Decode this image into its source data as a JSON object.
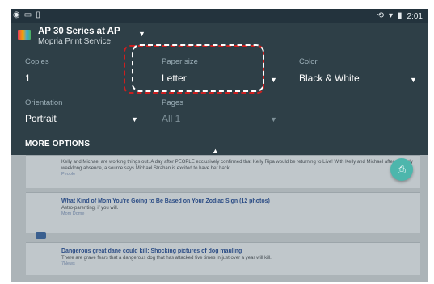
{
  "statusbar": {
    "left_icons": [
      "notification-icon",
      "sim-icon",
      "download-icon"
    ],
    "right_icons": [
      "sync-icon",
      "wifi-icon",
      "battery-icon"
    ],
    "time": "2:01"
  },
  "printer": {
    "name": "AP 30 Series at AP",
    "service": "Mopria Print Service"
  },
  "fields": {
    "copies": {
      "label": "Copies",
      "value": "1"
    },
    "paper_size": {
      "label": "Paper size",
      "value": "Letter"
    },
    "color": {
      "label": "Color",
      "value": "Black & White"
    },
    "orientation": {
      "label": "Orientation",
      "value": "Portrait"
    },
    "pages": {
      "label": "Pages",
      "value": "All 1"
    }
  },
  "more_options": "MORE OPTIONS",
  "articles": [
    {
      "title": "",
      "desc": "Kelly and Michael are working things out. A day after PEOPLE exclusively confirmed that Kelly Ripa would be returning to Live! With Kelly and Michael after a nearly weeklong absence, a source says Michael Strahan is excited to have her back.",
      "src": "People"
    },
    {
      "title": "What Kind of Mom You're Going to Be Based on Your Zodiac Sign (12 photos)",
      "desc": "Astro-parenting, if you will.",
      "src": "Mom Dome"
    },
    {
      "title": "Dangerous great dane could kill: Shocking pictures of dog mauling",
      "desc": "There are grave fears that a dangerous dog that has attacked five times in just over a year will kill.",
      "src": "7News"
    }
  ]
}
